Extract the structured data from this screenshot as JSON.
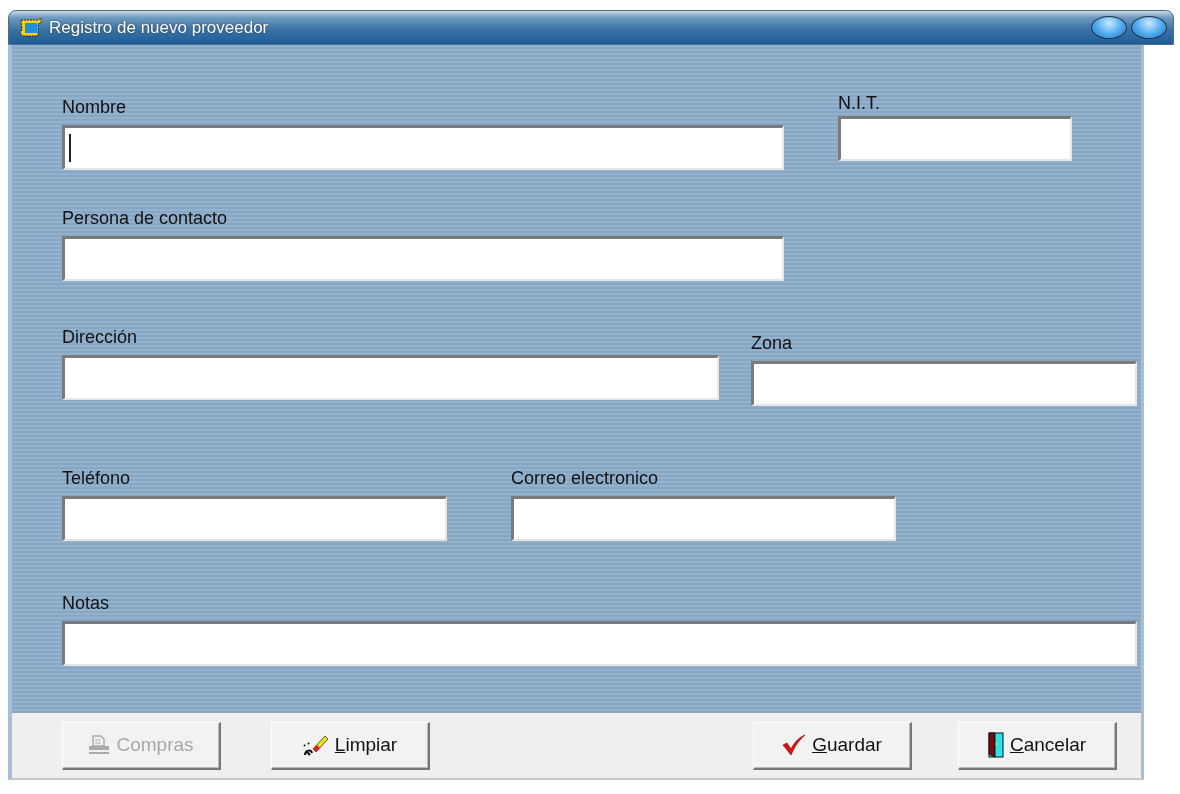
{
  "window": {
    "title": "Registro de nuevo proveedor"
  },
  "form": {
    "rows": [
      [
        {
          "label": "Nombre",
          "focused": true
        },
        {
          "label": "N.I.T.",
          "focused": false
        }
      ],
      [
        {
          "label": "Persona de contacto",
          "focused": false
        }
      ],
      [
        {
          "label": "Dirección",
          "focused": false
        },
        {
          "label": "Zona",
          "focused": false
        }
      ],
      [
        {
          "label": "Teléfono",
          "focused": false
        },
        {
          "label": "Correo electronico",
          "focused": false
        }
      ],
      [
        {
          "label": "Notas",
          "focused": false
        }
      ]
    ]
  },
  "buttons": [
    {
      "label": "Compras",
      "kind": "print",
      "disabled": true,
      "underline_first": false
    },
    {
      "label": "Limpiar",
      "kind": "clear",
      "disabled": false,
      "underline_first": true
    },
    {
      "label": "Guardar",
      "kind": "save",
      "disabled": false,
      "underline_first": true
    },
    {
      "label": "Cancelar",
      "kind": "cancel",
      "disabled": false,
      "underline_first": true
    }
  ]
}
